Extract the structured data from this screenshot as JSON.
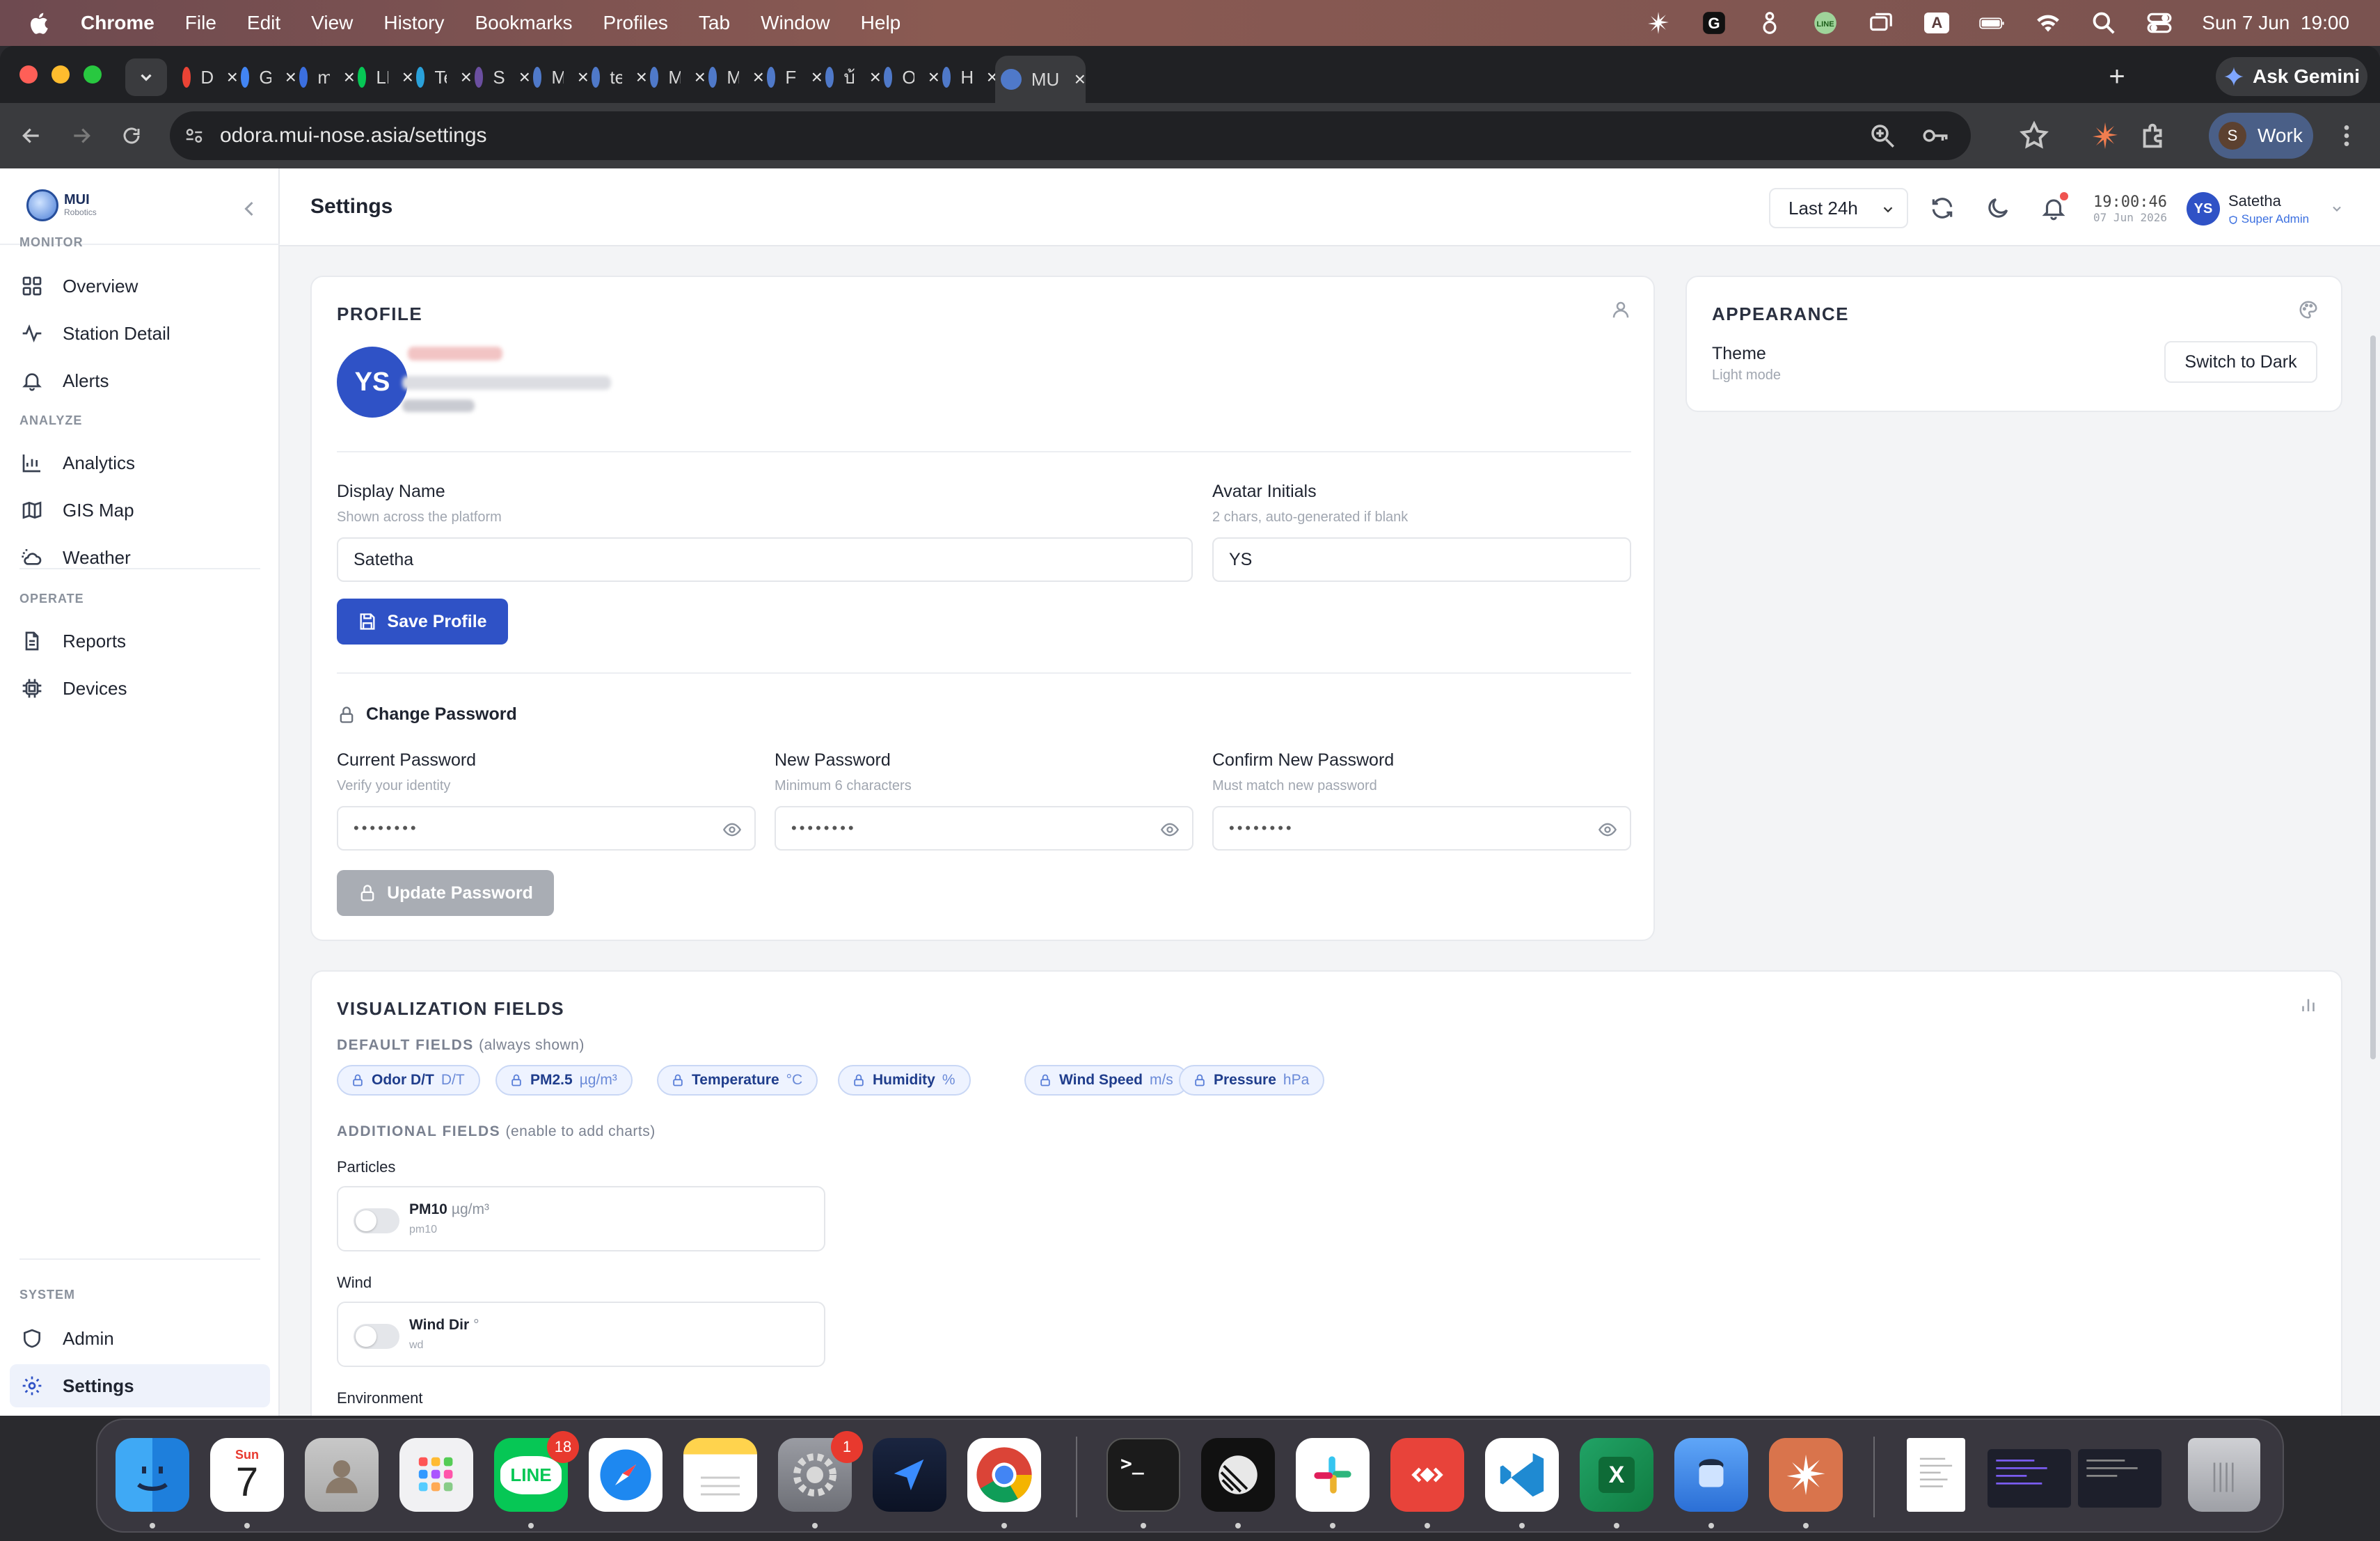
{
  "menubar": {
    "app_name": "Chrome",
    "items": [
      "File",
      "Edit",
      "View",
      "History",
      "Bookmarks",
      "Profiles",
      "Tab",
      "Window",
      "Help"
    ],
    "clock": "Sun 7 Jun  19:00",
    "input_source": "A"
  },
  "browser": {
    "tabs": [
      {
        "title": "Dra",
        "icon": "gmail-icon",
        "color": "#ea4335"
      },
      {
        "title": "Goo",
        "icon": "google-docs-icon",
        "color": "#4285f4"
      },
      {
        "title": "mui",
        "icon": "seven-icon",
        "color": "#3b6fe0"
      },
      {
        "title": "LINE",
        "icon": "line-icon",
        "color": "#06c755"
      },
      {
        "title": "Tele",
        "icon": "telegram-icon",
        "color": "#2aa1da"
      },
      {
        "title": "Stat",
        "icon": "circle-icon",
        "color": "#6b4fa0"
      },
      {
        "title": "Mul",
        "icon": "globe-icon",
        "color": "#4f79c9"
      },
      {
        "title": "tele",
        "icon": "globe-icon",
        "color": "#4f79c9"
      },
      {
        "title": "Mor",
        "icon": "globe-icon",
        "color": "#4f79c9"
      },
      {
        "title": "MU",
        "icon": "globe-icon",
        "color": "#4f79c9"
      },
      {
        "title": "Flee",
        "icon": "globe-icon",
        "color": "#4f79c9"
      },
      {
        "title": "บ้าน",
        "icon": "globe-icon",
        "color": "#4f79c9"
      },
      {
        "title": "Odo",
        "icon": "globe-icon",
        "color": "#4f79c9"
      },
      {
        "title": "Hor",
        "icon": "globe-icon",
        "color": "#4f79c9"
      },
      {
        "title": "MU",
        "icon": "globe-icon",
        "color": "#4f79c9",
        "active": true
      }
    ],
    "ask_gemini": "Ask Gemini",
    "url": "odora.mui-nose.asia/settings",
    "profile_label": "Work",
    "profile_initial": "S"
  },
  "app": {
    "brand": {
      "name": "MUI",
      "sub": "Robotics"
    },
    "sidebar": {
      "sections": [
        {
          "title": "MONITOR",
          "items": [
            {
              "label": "Overview",
              "icon": "grid-icon"
            },
            {
              "label": "Station Detail",
              "icon": "activity-icon"
            },
            {
              "label": "Alerts",
              "icon": "bell-icon"
            }
          ]
        },
        {
          "title": "ANALYZE",
          "items": [
            {
              "label": "Analytics",
              "icon": "bar-chart-icon"
            },
            {
              "label": "GIS Map",
              "icon": "map-icon"
            },
            {
              "label": "Weather",
              "icon": "cloud-sun-icon"
            }
          ]
        },
        {
          "title": "OPERATE",
          "items": [
            {
              "label": "Reports",
              "icon": "file-text-icon"
            },
            {
              "label": "Devices",
              "icon": "cpu-icon"
            }
          ]
        },
        {
          "title": "SYSTEM",
          "items": [
            {
              "label": "Admin",
              "icon": "shield-icon"
            },
            {
              "label": "Settings",
              "icon": "settings-icon",
              "active": true
            }
          ]
        }
      ]
    },
    "header": {
      "title": "Settings",
      "time_range": "Last 24h",
      "clock_time": "19:00:46",
      "clock_date": "07 Jun 2026",
      "user_initials": "YS",
      "user_name": "Satetha",
      "user_role": "Super Admin"
    },
    "profile": {
      "title": "PROFILE",
      "avatar_initials": "YS",
      "display_name_label": "Display Name",
      "display_name_hint": "Shown across the platform",
      "display_name_value": "Satetha",
      "avatar_initials_label": "Avatar Initials",
      "avatar_initials_hint": "2 chars, auto-generated if blank",
      "avatar_initials_value": "YS",
      "save_button": "Save Profile",
      "change_password_title": "Change Password",
      "current_password_label": "Current Password",
      "current_password_hint": "Verify your identity",
      "new_password_label": "New Password",
      "new_password_hint": "Minimum 6 characters",
      "confirm_password_label": "Confirm New Password",
      "confirm_password_hint": "Must match new password",
      "password_mask": "••••••••",
      "update_button": "Update Password"
    },
    "appearance": {
      "title": "APPEARANCE",
      "theme_label": "Theme",
      "theme_value": "Light mode",
      "switch_button": "Switch to Dark"
    },
    "visualization": {
      "title": "VISUALIZATION FIELDS",
      "default_heading": "DEFAULT FIELDS",
      "default_note": "(always shown)",
      "default_fields": [
        {
          "name": "Odor D/T",
          "unit": "D/T"
        },
        {
          "name": "PM2.5",
          "unit": "µg/m³"
        },
        {
          "name": "Temperature",
          "unit": "°C"
        },
        {
          "name": "Humidity",
          "unit": "%"
        },
        {
          "name": "Wind Speed",
          "unit": "m/s"
        },
        {
          "name": "Pressure",
          "unit": "hPa"
        }
      ],
      "additional_heading": "ADDITIONAL FIELDS",
      "additional_note": "(enable to add charts)",
      "groups": [
        {
          "title": "Particles",
          "fields": [
            {
              "name": "PM10",
              "unit": "µg/m³",
              "key": "pm10",
              "enabled": false
            }
          ]
        },
        {
          "title": "Wind",
          "fields": [
            {
              "name": "Wind Dir",
              "unit": "°",
              "key": "wd",
              "enabled": false
            }
          ]
        },
        {
          "title": "Environment",
          "fields": []
        }
      ]
    }
  },
  "dock": {
    "calendar_month": "Sun",
    "calendar_day": "7",
    "line_badge": "18",
    "settings_badge": "1",
    "line_label": "LINE",
    "terminal_label": ">_",
    "excel_label": "X"
  },
  "colors": {
    "accent": "#2f52c6",
    "notif_dot": "#ef5350"
  }
}
